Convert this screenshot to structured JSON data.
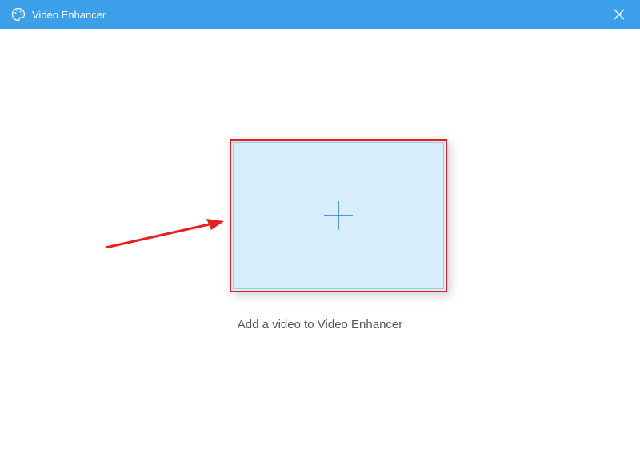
{
  "titlebar": {
    "app_name": "Video Enhancer",
    "icon": "palette-icon"
  },
  "main": {
    "instruction": "Add a video to Video Enhancer",
    "dropzone_icon": "plus-icon"
  },
  "annotations": {
    "arrow": "red-arrow",
    "highlight_color": "#e52020"
  },
  "colors": {
    "titlebar_bg": "#3ba0e9",
    "dropzone_bg": "#d7edfb",
    "plus_stroke": "#1e7bcc"
  }
}
